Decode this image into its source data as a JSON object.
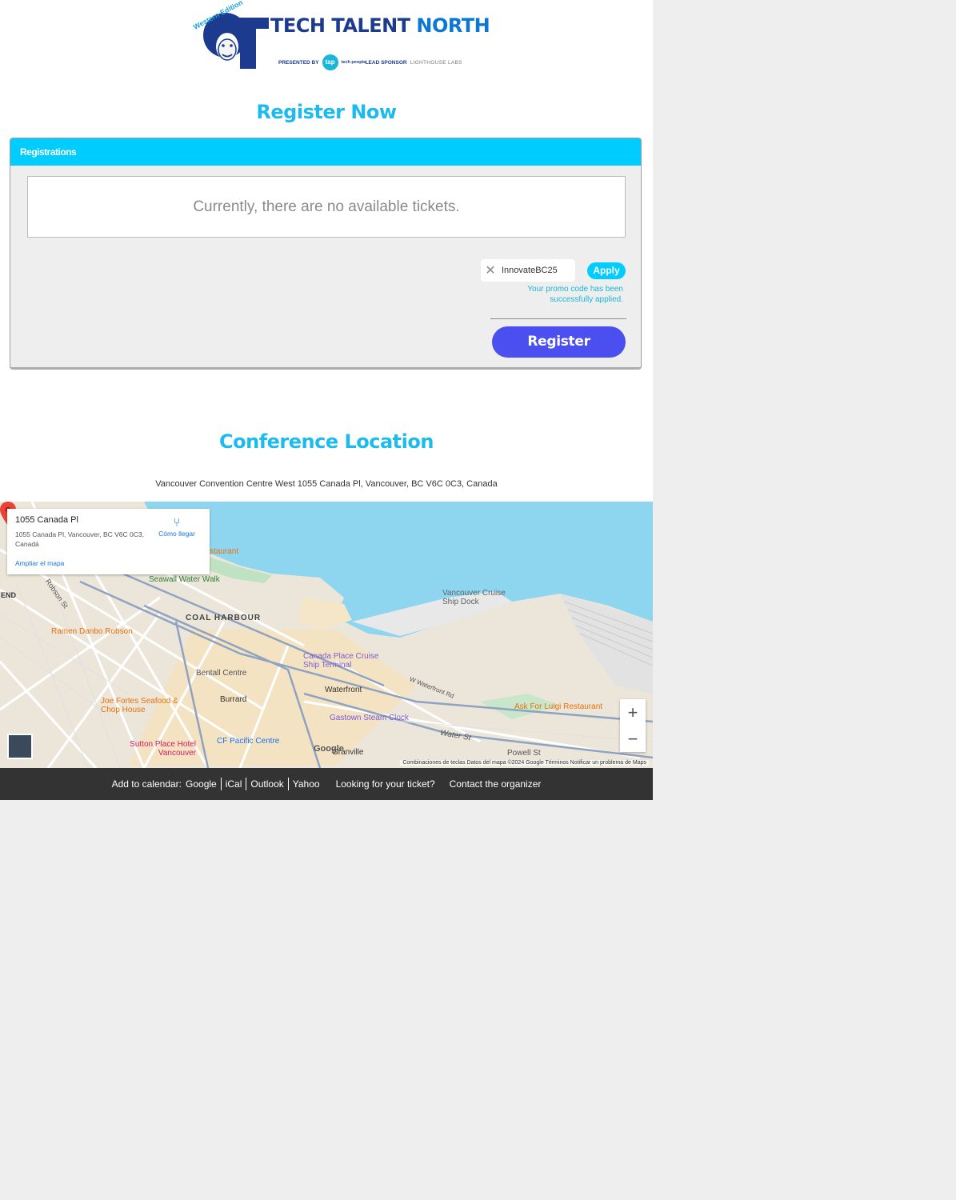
{
  "logo": {
    "title_part1": "TECH TALENT ",
    "title_part2": "NORTH",
    "edition": "Western Edition",
    "presented_by": "PRESENTED BY",
    "tap": "tap",
    "tech_people": "tech people",
    "lead_sponsor": "LEAD SPONSOR",
    "lighthouse": "LIGHTHOUSE LABS"
  },
  "register_heading": "Register Now",
  "panel": {
    "header": "Registrations",
    "notice": "Currently, there are no available tickets.",
    "promo_value": "InnovateBC25",
    "apply_label": "Apply",
    "promo_message": "Your promo code has been successfully applied.",
    "register_label": "Register"
  },
  "location_heading": "Conference Location",
  "address": "Vancouver Convention Centre West 1055 Canada Pl, Vancouver, BC V6C 0C3, Canada",
  "map": {
    "card_title": "1055 Canada Pl",
    "card_address": "1055 Canada Pl, Vancouver, BC V6C 0C3, Canadá",
    "directions": "Cómo llegar",
    "enlarge": "Ampliar el mapa",
    "zoom_in": "+",
    "zoom_out": "−",
    "google": "Google",
    "attribution": "Combinaciones de teclas   Datos del mapa ©2024 Google   Términos   Notificar un problema de Maps",
    "labels": {
      "seawall": "Seawall Water Walk",
      "coal_harbour": "COAL HARBOUR",
      "ramen": "Ramen Danbo Robson",
      "cruise_dock": "Vancouver Cruise Ship Dock",
      "canada_place": "Canada Place Cruise Ship Terminal",
      "bentall": "Bentall Centre",
      "waterfront": "Waterfront",
      "burrard": "Burrard",
      "joe_fortes": "Joe Fortes Seafood & Chop House",
      "gastown": "Gastown Steam Clock",
      "ask_luigi": "Ask For Luigi Restaurant",
      "cf_pacific": "CF Pacific Centre",
      "sutton": "Sutton Place Hotel Vancouver",
      "granville": "Granville",
      "water_st": "Water St",
      "powell_st": "Powell St",
      "w_waterfront_rd": "W Waterfront Rd",
      "robson_st": "Robson St",
      "restaurant": "staurant",
      "end": "END"
    }
  },
  "footer": {
    "add_to_calendar": "Add to calendar:",
    "google": "Google",
    "ical": "iCal",
    "outlook": "Outlook",
    "yahoo": "Yahoo",
    "looking": "Looking for your ticket?",
    "contact": "Contact the organizer"
  },
  "colors": {
    "accent": "#00cdfd",
    "heading": "#1bbbf0",
    "register_button": "#4b4ff0",
    "footer_bg": "#333333"
  }
}
